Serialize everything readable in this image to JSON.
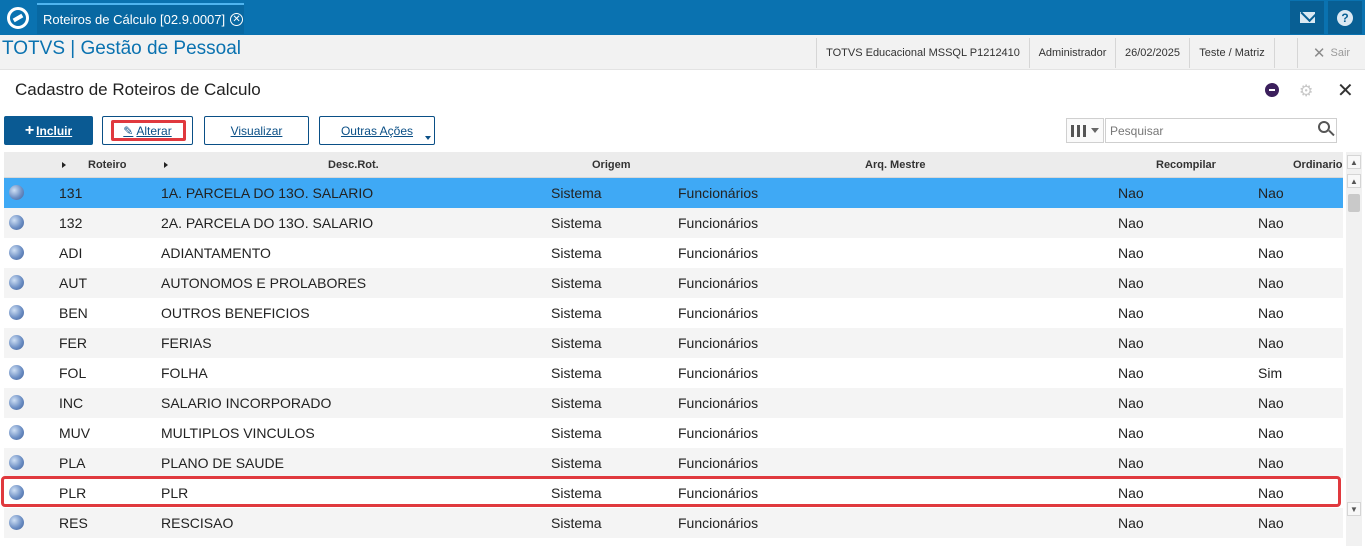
{
  "topbar": {
    "tab_title": "Roteiros de Cálculo [02.9.0007]",
    "icons": [
      "totvs-logo",
      "tab-close-icon",
      "mail-icon",
      "help-icon"
    ]
  },
  "appbar": {
    "title": "TOTVS | Gestão de Pessoal",
    "environment": "TOTVS Educacional MSSQL P1212410",
    "user": "Administrador",
    "date": "26/02/2025",
    "branch": "Teste / Matriz",
    "exit_label": "Sair"
  },
  "page": {
    "title": "Cadastro de Roteiros de Calculo"
  },
  "toolbar": {
    "incluir": "Incluir",
    "alterar": "Alterar",
    "visualizar": "Visualizar",
    "outras": "Outras Ações",
    "search_placeholder": "Pesquisar"
  },
  "grid": {
    "headers": {
      "roteiro": "Roteiro",
      "desc": "Desc.Rot.",
      "origem": "Origem",
      "arq": "Arq. Mestre",
      "recompilar": "Recompilar",
      "ordinario": "Ordinario"
    },
    "rows": [
      {
        "roteiro": "131",
        "desc": "1A. PARCELA DO 13O. SALARIO",
        "origem": "Sistema",
        "arq": "Funcionários",
        "recompilar": "Nao",
        "ordinario": "Nao",
        "selected": true
      },
      {
        "roteiro": "132",
        "desc": "2A. PARCELA DO 13O. SALARIO",
        "origem": "Sistema",
        "arq": "Funcionários",
        "recompilar": "Nao",
        "ordinario": "Nao"
      },
      {
        "roteiro": "ADI",
        "desc": "ADIANTAMENTO",
        "origem": "Sistema",
        "arq": "Funcionários",
        "recompilar": "Nao",
        "ordinario": "Nao"
      },
      {
        "roteiro": "AUT",
        "desc": "AUTONOMOS E PROLABORES",
        "origem": "Sistema",
        "arq": "Funcionários",
        "recompilar": "Nao",
        "ordinario": "Nao"
      },
      {
        "roteiro": "BEN",
        "desc": "OUTROS BENEFICIOS",
        "origem": "Sistema",
        "arq": "Funcionários",
        "recompilar": "Nao",
        "ordinario": "Nao"
      },
      {
        "roteiro": "FER",
        "desc": "FERIAS",
        "origem": "Sistema",
        "arq": "Funcionários",
        "recompilar": "Nao",
        "ordinario": "Nao"
      },
      {
        "roteiro": "FOL",
        "desc": "FOLHA",
        "origem": "Sistema",
        "arq": "Funcionários",
        "recompilar": "Nao",
        "ordinario": "Sim"
      },
      {
        "roteiro": "INC",
        "desc": "SALARIO INCORPORADO",
        "origem": "Sistema",
        "arq": "Funcionários",
        "recompilar": "Nao",
        "ordinario": "Nao"
      },
      {
        "roteiro": "MUV",
        "desc": "MULTIPLOS VINCULOS",
        "origem": "Sistema",
        "arq": "Funcionários",
        "recompilar": "Nao",
        "ordinario": "Nao"
      },
      {
        "roteiro": "PLA",
        "desc": "PLANO DE SAUDE",
        "origem": "Sistema",
        "arq": "Funcionários",
        "recompilar": "Nao",
        "ordinario": "Nao"
      },
      {
        "roteiro": "PLR",
        "desc": "PLR",
        "origem": "Sistema",
        "arq": "Funcionários",
        "recompilar": "Nao",
        "ordinario": "Nao",
        "highlighted": true
      },
      {
        "roteiro": "RES",
        "desc": "RESCISAO",
        "origem": "Sistema",
        "arq": "Funcionários",
        "recompilar": "Nao",
        "ordinario": "Nao"
      }
    ]
  },
  "colors": {
    "brand": "#0a72b0",
    "selected_row": "#3fa9f5",
    "highlight": "#e0393e"
  }
}
